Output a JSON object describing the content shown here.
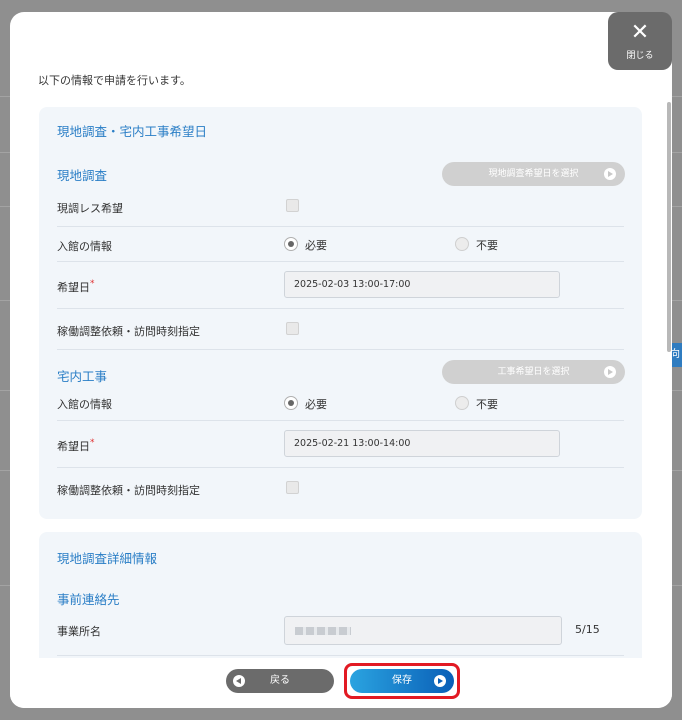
{
  "close": {
    "label": "閉じる",
    "icon": "close-icon"
  },
  "intro": "以下の情報で申請を行います。",
  "schedule_section": {
    "title": "現地調査・宅内工事希望日",
    "survey": {
      "title": "現地調査",
      "select_button": "現地調査希望日を選択",
      "no_survey_label": "現調レス希望",
      "entry_label": "入館の情報",
      "radio_required": "必要",
      "radio_not_required": "不要",
      "date_label": "希望日",
      "date_value": "2025-02-03  13:00-17:00",
      "adjust_label": "稼働調整依頼・訪問時刻指定"
    },
    "construction": {
      "title": "宅内工事",
      "select_button": "工事希望日を選択",
      "entry_label": "入館の情報",
      "radio_required": "必要",
      "radio_not_required": "不要",
      "date_label": "希望日",
      "date_value": "2025-02-21  13:00-14:00",
      "adjust_label": "稼働調整依頼・訪問時刻指定"
    }
  },
  "detail_section": {
    "title": "現地調査詳細情報",
    "contact_title": "事前連絡先",
    "office_label": "事業所名",
    "office_counter": "5/15"
  },
  "footer": {
    "back_label": "戻る",
    "save_label": "保存"
  },
  "colors": {
    "accent": "#2a7ec6",
    "save_gradient_start": "#2aa3e0",
    "save_gradient_end": "#0a5fb7",
    "highlight": "#e21a23"
  }
}
